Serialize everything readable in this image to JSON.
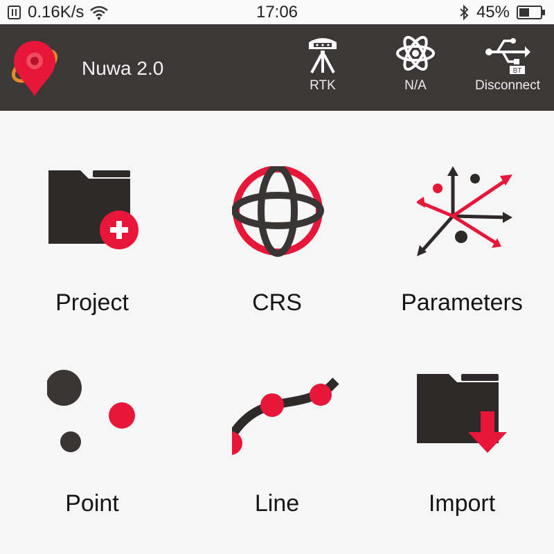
{
  "status_bar": {
    "network_speed": "0.16K/s",
    "time": "17:06",
    "battery": "45%"
  },
  "header": {
    "app_title": "Nuwa 2.0",
    "buttons": [
      {
        "label": "RTK",
        "icon": "gnss-receiver-icon"
      },
      {
        "label": "N/A",
        "icon": "atom-icon"
      },
      {
        "label": "Disconnect",
        "icon": "usb-bt-icon"
      }
    ]
  },
  "tiles": [
    {
      "label": "Project",
      "icon": "folder-add-icon"
    },
    {
      "label": "CRS",
      "icon": "globe-icon"
    },
    {
      "label": "Parameters",
      "icon": "parameters-icon"
    },
    {
      "label": "Point",
      "icon": "points-icon"
    },
    {
      "label": "Line",
      "icon": "line-icon"
    },
    {
      "label": "Import",
      "icon": "folder-import-icon"
    }
  ],
  "colors": {
    "header_bg": "#3c3837",
    "accent": "#e8173a",
    "icon_dark": "#2e2a2a"
  }
}
